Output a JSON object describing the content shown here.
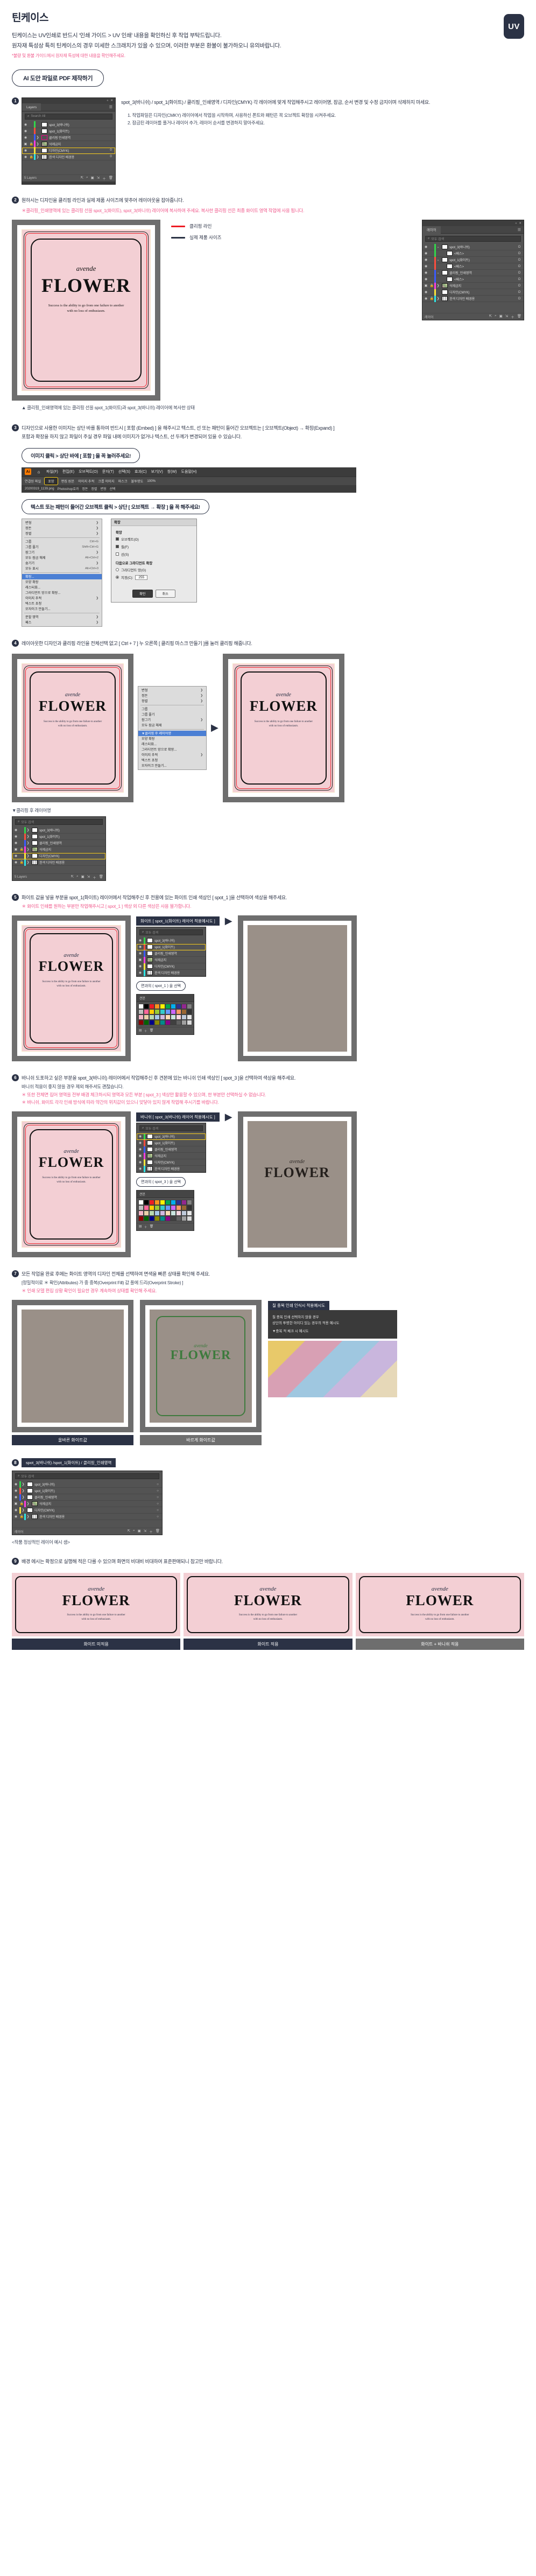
{
  "header": {
    "title": "틴케이스",
    "line1": "틴케이스는 UV인쇄로 반드시 '인쇄 가이드 > UV 인쇄' 내용을 확인하신 후 작업 부탁드립니다.",
    "line2": "원자재 특성상 특히 틴케이스의 경우 미세한 스크래치가 있을 수 있으며, 이러한 부분은 환불이 불가하오니 유의바랍니다.",
    "note": "*불량 및 환불 가이드에서 원자재 특성에 대한 내용을 확인해주세요.",
    "uv_badge": "UV"
  },
  "main_pill": "AI 도안 파일로 PDF 제작하기",
  "step1": {
    "num": "1",
    "text_main": "spot_3(바니쉬) / spot_1(화이트) / 클리핑_인쇄영역 / 디자인(CMYK) 각 레이어에 맞게 작업해주시고 레이어명, 잠금, 순서 변경 및 수정 금지이며 삭제하지 마세요.",
    "bullets": [
      "1. 작업파일은 디자인(CMKY) 레이어에서 작업을 시작하며, 사용하신 폰트와 패턴은 꼭 오브젝트 확장을 시켜주세요.",
      "2. 잠금된 레이어를 풀거나 레이어 추가, 레이어 순서를 변경하지 말아주세요."
    ]
  },
  "layers_panel_1": {
    "tab": "Layers",
    "search_placeholder": "Search All",
    "footer_count": "5 Layers",
    "rows": [
      {
        "name": "spot_3(바니쉬)",
        "color": "#32d74b",
        "eye": true,
        "lock": false,
        "arrow": false,
        "count": "",
        "thumb": "white"
      },
      {
        "name": "spot_1(화이트)",
        "color": "#ff4d3d",
        "eye": true,
        "lock": false,
        "arrow": false,
        "count": "",
        "thumb": "white"
      },
      {
        "name": "클리핑 인쇄영역",
        "color": "#3b5bff",
        "eye": true,
        "lock": false,
        "arrow": true,
        "count": "",
        "thumb": "outline"
      },
      {
        "name": "삭제금지",
        "color": "#ff3de0",
        "eye": true,
        "lock": true,
        "arrow": true,
        "count": "",
        "thumb": "image"
      },
      {
        "name": "디자인(CMYK)",
        "color": "#ffe53b",
        "eye": true,
        "lock": false,
        "arrow": false,
        "count": "0",
        "thumb": "white",
        "highlight": true
      },
      {
        "name": "흰색 디자인 배경용",
        "color": "#2ee6e6",
        "eye": true,
        "lock": true,
        "arrow": true,
        "count": "0",
        "thumb": "stripe"
      }
    ]
  },
  "step2": {
    "num": "2",
    "text_main": "원하시는 디자인을 클리핑 라인과 실제 제품 사이즈에 맞추어 레이아웃을 잡아줍니다.",
    "note": "＊클리핑_인쇄영역에 있는 클리핑 선을 spot_1(화이트), spot_3(바니쉬) 레이어에 복사하여 주세요. 복사한 클리핑 선은 최종 화이트 영역 작업에 사용 됩니다.",
    "legend": [
      {
        "label": "클리핑 라인",
        "color": "#ed1c24"
      },
      {
        "label": "실제 제품 사이즈",
        "color": "#2b3245"
      }
    ],
    "caption": "▲ 클리핑_인쇄영역에 있는 클리핑 선을 spot_1(화이트)과 spot_3(바니쉬) 레이어에 복사한 상태"
  },
  "layers_panel_2": {
    "search_placeholder": "모두 검색",
    "rows": [
      {
        "name": "spot_3(바니쉬)",
        "expand": true,
        "count": "O"
      },
      {
        "name": "<패스>",
        "child": true,
        "count": "O"
      },
      {
        "name": "spot_1(화이트)",
        "expand": true,
        "count": "O"
      },
      {
        "name": "<패스>",
        "child": true,
        "count": "O"
      },
      {
        "name": "클리핑_인쇄영역",
        "expand": true,
        "count": "O"
      },
      {
        "name": "<패스>",
        "child": true,
        "count": "O"
      },
      {
        "name": "삭제금지",
        "lock": true,
        "arrow": true,
        "count": "O"
      },
      {
        "name": "디자인(CMYK)",
        "count": "O"
      },
      {
        "name": "흰색 디자인 배경용",
        "lock": true,
        "arrow": true,
        "count": "O"
      }
    ],
    "footer": "레이어"
  },
  "artwork": {
    "brand": "avende",
    "title": "FLOWER",
    "quote_line1": "Success is the ability to go from one failure to another",
    "quote_line2": "with no loss of enthusiasm."
  },
  "step3": {
    "num": "3",
    "text_main": "디자인으로 사용한 이미지는 상단 바를 통하여 반드시 [ 포함 (Embed) ] 을 해주시고 텍스트, 선 또는 패턴이 들어간 오브젝트는 [ 오브젝트(Object) → 확장(Expand) ]",
    "text_sub": "포함과 확장을 하지 않고 파일이 주실 경우 파일 내에 이미지가 없거나 텍스트, 선 두께가 변경되어 있을 수 있습니다.",
    "pill": "이미지 클릭 > 상단 바에 [ 포함 ] 을 꼭 눌러주세요!",
    "menubar": [
      "파일(F)",
      "편집(E)",
      "오브젝트(O)",
      "문자(T)",
      "선택(S)",
      "효과(C)",
      "보기(V)",
      "창(W)",
      "도움말(H)"
    ],
    "toolbar2_left": "연결된 파일",
    "toolbar2_items": [
      "포함",
      "편집 원본",
      "이미지 추적",
      "크롭 이미지",
      "마스크",
      "불투명도",
      "100%"
    ],
    "toolbar3_items": [
      "20200319_1139.png",
      "Photoshop효과",
      "정돈",
      "정렬",
      "변형",
      "선택"
    ],
    "expand_label": "텍스트 또는 패턴이 들어간 오브젝트 클릭 > 상단 [ 오브젝트 → 확장 ] 을 꼭 해주세요!"
  },
  "menu_object": {
    "items": [
      {
        "label": "변형",
        "arrow": true
      },
      {
        "label": "정돈",
        "arrow": true
      },
      {
        "label": "정렬",
        "arrow": true
      },
      {
        "label": "그룹",
        "key": "Ctrl+G"
      },
      {
        "label": "그룹 풀기",
        "key": "Shift+Ctrl+G"
      },
      {
        "label": "잠그기",
        "arrow": true
      },
      {
        "label": "모두 잠금 해제",
        "key": "Alt+Ctrl+2"
      },
      {
        "label": "숨기기",
        "arrow": true
      },
      {
        "label": "모두 표시",
        "key": "Alt+Ctrl+3"
      },
      {
        "label": "확장...",
        "hl": true
      },
      {
        "label": "모양 확장"
      },
      {
        "label": "래스터화...",
        "arrow": false
      },
      {
        "label": "그라디언트 망으로 확장..."
      },
      {
        "label": "이미지 추적",
        "arrow": true
      },
      {
        "label": "텍스트 초청"
      },
      {
        "label": "모자이크 만들기..."
      },
      {
        "label": "분할 영역"
      },
      {
        "label": "패스"
      }
    ]
  },
  "dialog_expand": {
    "title": "확장",
    "section_label": "확장",
    "options": [
      {
        "label": "오브젝트(O)",
        "checked": true
      },
      {
        "label": "칠(F)",
        "checked": true
      },
      {
        "label": "선(S)",
        "checked": false
      }
    ],
    "gradient_label": "다음으로 그라디언트 확장",
    "gradient_options": [
      {
        "label": "그라디언트 망(G)",
        "on": false
      },
      {
        "label": "지정(C):",
        "on": true,
        "value": "255"
      },
      {
        "label": "오브젝트"
      }
    ],
    "buttons": {
      "ok": "확인",
      "cancel": "취소"
    }
  },
  "step4": {
    "num": "4",
    "text_main": "레이아웃한 디자인과 클리핑 라인을 전체선택 없고 [ Ctrl + 7 ] 누 오른쪽 [ 클리핑 마스크 만들기 ]를 눌러 클리핑 해줍니다.",
    "caption_left": "▼클리핑 후 레이어명",
    "footer_count": "5 Layers"
  },
  "layers_panel_3": {
    "rows": [
      {
        "name": "spot_3(바니쉬)"
      },
      {
        "name": "spot_1(화이트)"
      },
      {
        "name": "클리핑_인쇄영역"
      },
      {
        "name": "삭제금지",
        "lock": true
      },
      {
        "name": "디자인(CMYK)",
        "highlight": true
      },
      {
        "name": "흰색 디자인 배경용",
        "lock": true
      }
    ],
    "footer": "5 Layers"
  },
  "step5": {
    "num": "5",
    "text_main": "화이트 값을 넣을 부분을 spot_1(화이트) 레이어에서 작업해주신 후 전용에 있는 화이트 인쇄 색상인 [ spot_1 ]을 선택하여 색상을 해주세요.",
    "sub": "＊ 화이트 인쇄를 원하는 부분만 작업해주시고 [ spot_1 ] 색상 외 다른 색상은 사용 불가합니다.",
    "panel_title": "화이트 [ spot_1(화이트) 레이어 적용예시도 ]",
    "callout": "면과의 ( spot_1 ) 을 선택",
    "swatch_label": "견본"
  },
  "step6": {
    "num": "6",
    "text_main": "바니쉬 도포하고 싶은 부분을 spot_3(바니쉬) 레이어에서 작업해주신 후 견본에 있는 바니쉬 인쇄 색상인 [ spot_3 ]을 선택하여 색상을 해주세요.",
    "sub1": "바니쉬 적용이 좋지 않을 경우 제외 해주셔도 괜찮습니다.",
    "sub2": "＊ 또한 전체면 집어 영역을 전부 배경 체크하시되 영역과 모든 부분 [ spot_3 ] 색상만 활용할 수 있으며, 한 부분만 선택하실 수 없습니다.",
    "sub3": "＊ 바니쉬, 화이트 각각 인쇄 방식에 따라 약간의 위치값이 있으니 맞닿아 있지 않게 작업해 주시기를 바랍니다.",
    "panel_title": "바니쉬 [ spot_3(바니쉬) 레이어 적용예시도 ]",
    "callout": "면과의 ( spot_3 ) 을 선택"
  },
  "step7": {
    "num": "7",
    "text_main": "모든 작업을 완료 후에는 화이트 영역의 디자인 전체를 선택하여 면색을 빠른 상태를 확인해 주세요.",
    "sub1": "[정밀적이로 ＊ 확인(Attributes) 가 중 중복(Overprint Fill) 값 풀에 드리(Overprint Stroke) ]",
    "sub2": "＊ 인쇄 모델 편집 상황 확인이 필요한 경우 계속하여 상태를 확인해 주세요.",
    "cap_left": "올바른 화이트값",
    "cap_right": "바르게 화이트값",
    "right_title": "칠 중복 인쇄 인식시 적용예시도",
    "right_note1": "칠 중복 인쇄 선택하지 않을 경우",
    "right_note2": "상단의 투명한 아이디 있는 경우의 적용 예시도",
    "right_note3": "▼중복 적 체크 시 예시도"
  },
  "step8": {
    "num": "8",
    "badge": "spot_3(바니쉬) /spot_1(화이트) / 클리핑_인쇄영역",
    "footer_note": "<작품 정상적인 레이어 예시 샘>"
  },
  "layers_panel_4": {
    "rows": [
      {
        "name": "spot_3(바니쉬)"
      },
      {
        "name": "spot_1(화이트)"
      },
      {
        "name": "클리핑_인쇄영역"
      },
      {
        "name": "삭제금지",
        "lock": true
      },
      {
        "name": "디자인(CMYK)"
      },
      {
        "name": "흰색 디자인 배경용",
        "lock": true
      }
    ]
  },
  "step9": {
    "num": "9",
    "text_main": "배경 에시는 확정으로 실행해 적은 다를 수 있으며 화면의 비대비 비대하여 표준판매되니 참고만 바랍니다."
  },
  "bottom_thumbs": [
    {
      "caption": "화이트 미적용",
      "dark": true
    },
    {
      "caption": "화이트 적용",
      "dark": true
    },
    {
      "caption": "화이트 + 바니쉬 적용",
      "dark": false
    }
  ],
  "swatch_colors": [
    "#ffffff",
    "#000000",
    "#ed1c24",
    "#f7941e",
    "#fff200",
    "#00a651",
    "#00aeef",
    "#2e3192",
    "#92278f",
    "#808080",
    "#c0c0c0",
    "#ff6699",
    "#ffcc00",
    "#99cc33",
    "#33cccc",
    "#6699ff",
    "#cc66ff",
    "#ff9966",
    "#996633",
    "#333333",
    "#f4b5c7",
    "#e8d0a9",
    "#b8d8b0",
    "#a8c8e8",
    "#d0b8e0",
    "#ffd9b3",
    "#c9e4de",
    "#f7d6e0",
    "#bfc9d9",
    "#e6e6e6",
    "#8b0000",
    "#006400",
    "#00008b",
    "#8b8b00",
    "#008b8b",
    "#8b008b",
    "#404040",
    "#606060",
    "#a0a0a0",
    "#d9d9d9"
  ]
}
